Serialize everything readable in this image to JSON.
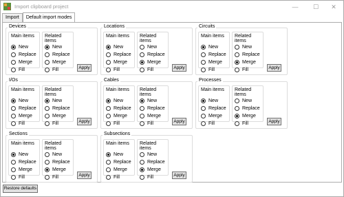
{
  "window": {
    "title": "Import clipboard project",
    "controls": {
      "minimize": "—",
      "maximize": "☐",
      "close": "✕"
    }
  },
  "tabs": [
    {
      "label": "Import",
      "active": false
    },
    {
      "label": "Default import modes",
      "active": true
    }
  ],
  "labels": {
    "main_items": "Main items",
    "related_items": "Related items",
    "options": [
      "New",
      "Replace",
      "Merge",
      "Fill"
    ],
    "apply": "Apply"
  },
  "groups": [
    {
      "name": "Devices",
      "main": "New",
      "related": "New"
    },
    {
      "name": "Locations",
      "main": "New",
      "related": "Merge"
    },
    {
      "name": "Circuits",
      "main": "New",
      "related": "Merge"
    },
    {
      "name": "I/Os",
      "main": "New",
      "related": "New"
    },
    {
      "name": "Cables",
      "main": "New",
      "related": "New"
    },
    {
      "name": "Processes",
      "main": "New",
      "related": "Merge"
    },
    {
      "name": "Sections",
      "main": "New",
      "related": "Merge"
    },
    {
      "name": "Subsections",
      "main": "New",
      "related": "Merge"
    }
  ],
  "restore_defaults": "Restore defaults",
  "colors": {
    "selected_tab": "#ffffff",
    "button": "#e1e1e1",
    "border": "#adadad"
  }
}
